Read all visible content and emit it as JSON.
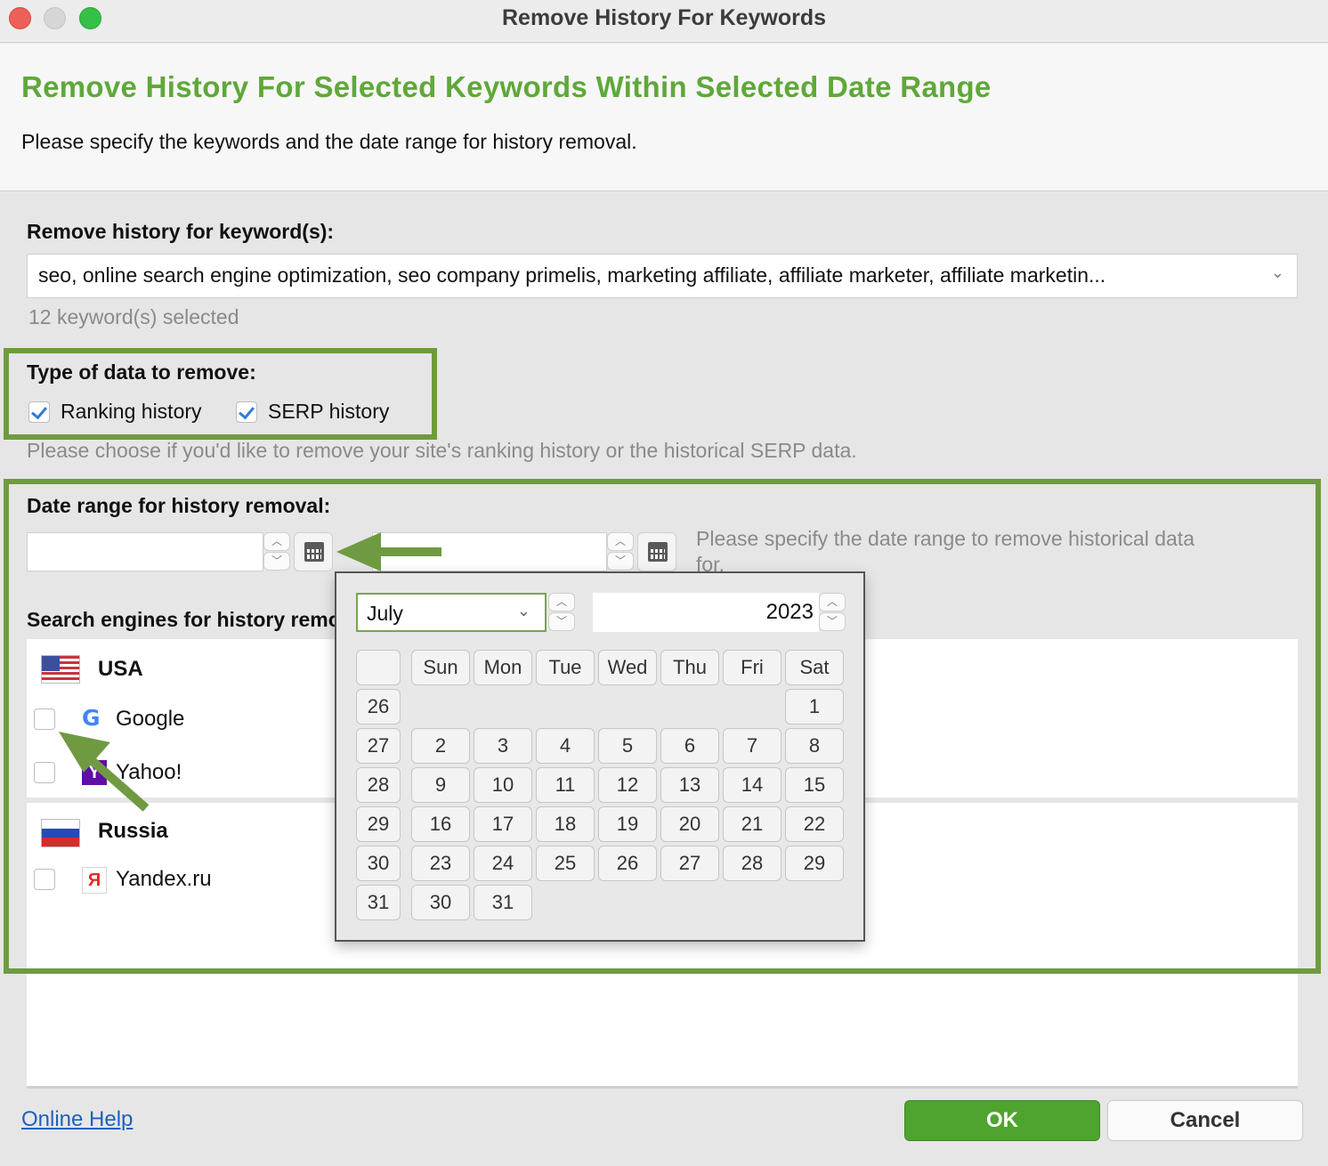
{
  "window": {
    "title": "Remove History For Keywords"
  },
  "header": {
    "title": "Remove History For Selected Keywords Within Selected Date Range",
    "subtitle": "Please specify the keywords and the date range for history removal."
  },
  "keywords": {
    "label": "Remove history for keyword(s):",
    "value": "seo, online search engine optimization, seo company primelis, marketing affiliate, affiliate marketer, affiliate marketin...",
    "count_text": "12 keyword(s) selected"
  },
  "data_type": {
    "label": "Type of data to remove:",
    "ranking_label": "Ranking history",
    "ranking_checked": true,
    "serp_label": "SERP history",
    "serp_checked": true,
    "hint": "Please choose if you'd like to remove your site's ranking history or the historical SERP data."
  },
  "date_range": {
    "label": "Date range for history removal:",
    "from_value": "",
    "to_value": "",
    "hint_line1": "Please specify the date range to remove historical data",
    "hint_line2": "for."
  },
  "engines": {
    "label_visible": "Search engines for history re",
    "label_trailing": "moval:",
    "countries": [
      {
        "name": "USA",
        "flag": "usa-flag-icon",
        "engines": [
          {
            "name": "Google",
            "icon": "google-icon",
            "checked": false
          },
          {
            "name": "Yahoo!",
            "icon": "yahoo-icon",
            "checked": false
          }
        ]
      },
      {
        "name": "Russia",
        "flag": "russia-flag-icon",
        "engines": [
          {
            "name": "Yandex.ru",
            "icon": "yandex-icon",
            "checked": false
          }
        ]
      }
    ]
  },
  "calendar": {
    "month": "July",
    "year": "2023",
    "day_headers": [
      "Sun",
      "Mon",
      "Tue",
      "Wed",
      "Thu",
      "Fri",
      "Sat"
    ],
    "week_numbers": [
      "26",
      "27",
      "28",
      "29",
      "30",
      "31"
    ],
    "weeks": [
      [
        "",
        "",
        "",
        "",
        "",
        "",
        "1"
      ],
      [
        "2",
        "3",
        "4",
        "5",
        "6",
        "7",
        "8"
      ],
      [
        "9",
        "10",
        "11",
        "12",
        "13",
        "14",
        "15"
      ],
      [
        "16",
        "17",
        "18",
        "19",
        "20",
        "21",
        "22"
      ],
      [
        "23",
        "24",
        "25",
        "26",
        "27",
        "28",
        "29"
      ],
      [
        "30",
        "31",
        "",
        "",
        "",
        "",
        ""
      ]
    ]
  },
  "footer": {
    "help_link": "Online Help",
    "ok_label": "OK",
    "cancel_label": "Cancel"
  },
  "colors": {
    "accent_green": "#5fa839",
    "highlight_green": "#6f9a41",
    "ok_button": "#4fa32f",
    "link_blue": "#1f5fbf"
  }
}
